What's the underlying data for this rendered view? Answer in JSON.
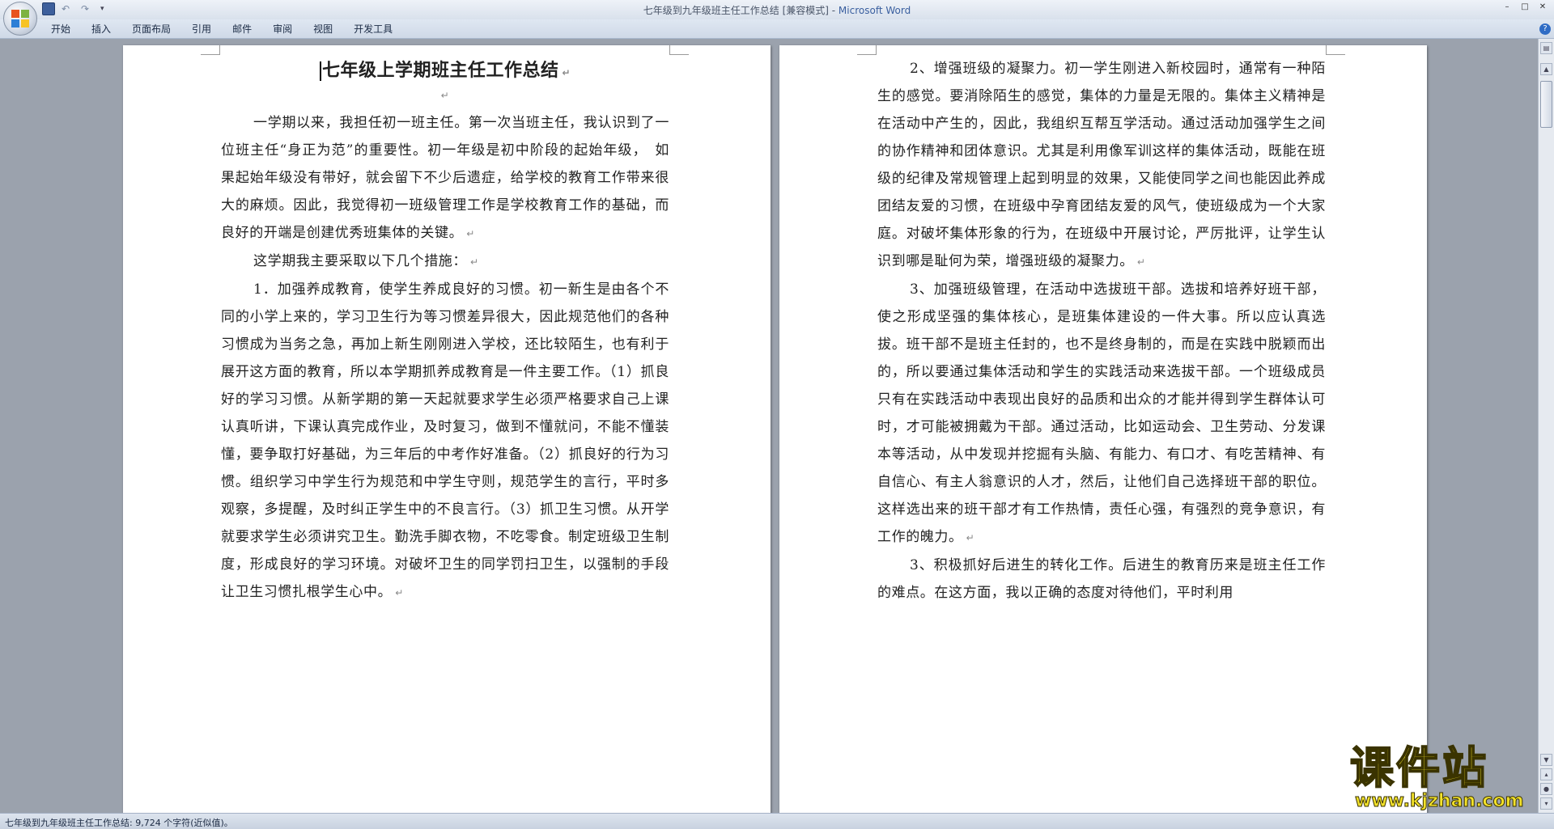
{
  "window": {
    "title": "七年级到九年级班主任工作总结 [兼容模式] - ",
    "app_name": "Microsoft Word",
    "controls": [
      "–",
      "□",
      "✕"
    ]
  },
  "ribbon": {
    "tabs": [
      "开始",
      "插入",
      "页面布局",
      "引用",
      "邮件",
      "审阅",
      "视图",
      "开发工具"
    ]
  },
  "page1": {
    "title": "七年级上学期班主任工作总结",
    "paragraphs": [
      "一学期以来，我担任初一班主任。第一次当班主任，我认识到了一位班主任“身正为范”的重要性。初一年级是初中阶段的起始年级，　如果起始年级没有带好，就会留下不少后遗症，给学校的教育工作带来很大的麻烦。因此，我觉得初一班级管理工作是学校教育工作的基础，而良好的开端是创建优秀班集体的关键。",
      "这学期我主要采取以下几个措施：",
      "1．加强养成教育，使学生养成良好的习惯。初一新生是由各个不同的小学上来的，学习卫生行为等习惯差异很大，因此规范他们的各种习惯成为当务之急，再加上新生刚刚进入学校，还比较陌生，也有利于展开这方面的教育，所以本学期抓养成教育是一件主要工作。（1）抓良好的学习习惯。从新学期的第一天起就要求学生必须严格要求自己上课认真听讲，下课认真完成作业，及时复习，做到不懂就问，不能不懂装懂，要争取打好基础，为三年后的中考作好准备。（2）抓良好的行为习惯。组织学习中学生行为规范和中学生守则，规范学生的言行，平时多观察，多提醒，及时纠正学生中的不良言行。（3）抓卫生习惯。从开学就要求学生必须讲究卫生。勤洗手脚衣物，不吃零食。制定班级卫生制度，形成良好的学习环境。对破坏卫生的同学罚扫卫生，以强制的手段让卫生习惯扎根学生心中。"
    ]
  },
  "page2": {
    "paragraphs": [
      "2、增强班级的凝聚力。初一学生刚进入新校园时，通常有一种陌生的感觉。要消除陌生的感觉，集体的力量是无限的。集体主义精神是在活动中产生的，因此，我组织互帮互学活动。通过活动加强学生之间的协作精神和团体意识。尤其是利用像军训这样的集体活动，既能在班级的纪律及常规管理上起到明显的效果，又能使同学之间也能因此养成团结友爱的习惯，在班级中孕育团结友爱的风气，使班级成为一个大家庭。对破坏集体形象的行为，在班级中开展讨论，严厉批评，让学生认识到哪是耻何为荣，增强班级的凝聚力。",
      "3、加强班级管理，在活动中选拔班干部。选拔和培养好班干部，使之形成坚强的集体核心，是班集体建设的一件大事。所以应认真选拔。班干部不是班主任封的，也不是终身制的，而是在实践中脱颖而出的，所以要通过集体活动和学生的实践活动来选拔干部。一个班级成员只有在实践活动中表现出良好的品质和出众的才能并得到学生群体认可时，才可能被拥戴为干部。通过活动，比如运动会、卫生劳动、分发课本等活动，从中发现并挖掘有头脑、有能力、有口才、有吃苦精神、有自信心、有主人翁意识的人才，然后，让他们自己选择班干部的职位。这样选出来的班干部才有工作热情，责任心强，有强烈的竞争意识，有工作的魄力。",
      "3、积极抓好后进生的转化工作。后进生的教育历来是班主任工作的难点。在这方面，我以正确的态度对待他们，平时利用"
    ]
  },
  "status": {
    "text": "七年级到九年级班主任工作总结: 9,724 个字符(近似值)。"
  },
  "watermark": {
    "title": "课件站",
    "url": "www.kjzhan.com"
  },
  "colors": {
    "app_blue": "#3a5f9f",
    "watermark_yellow": "#f3e22a"
  }
}
